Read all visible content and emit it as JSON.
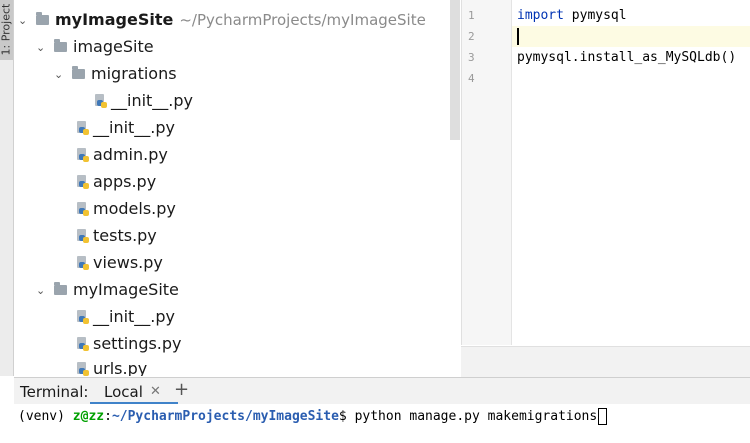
{
  "sidebar": {
    "project_tab_label": "1: Project"
  },
  "tree": {
    "root": {
      "name": "myImageSite",
      "path": "~/PycharmProjects/myImageSite"
    },
    "items": [
      {
        "label": "imageSite",
        "kind": "folder",
        "expanded": true
      },
      {
        "label": "migrations",
        "kind": "folder",
        "expanded": true
      },
      {
        "label": "__init__.py",
        "kind": "py"
      },
      {
        "label": "__init__.py",
        "kind": "py"
      },
      {
        "label": "admin.py",
        "kind": "py"
      },
      {
        "label": "apps.py",
        "kind": "py"
      },
      {
        "label": "models.py",
        "kind": "py"
      },
      {
        "label": "tests.py",
        "kind": "py"
      },
      {
        "label": "views.py",
        "kind": "py"
      },
      {
        "label": "myImageSite",
        "kind": "folder",
        "expanded": true
      },
      {
        "label": "__init__.py",
        "kind": "py"
      },
      {
        "label": "settings.py",
        "kind": "py"
      },
      {
        "label": "urls.py",
        "kind": "py"
      }
    ]
  },
  "editor": {
    "line_numbers": [
      "1",
      "2",
      "3",
      "4"
    ],
    "lines": {
      "l1_keyword": "import",
      "l1_rest": " pymysql",
      "l3": "pymysql.install_as_MySQLdb()"
    }
  },
  "terminal": {
    "label": "Terminal:",
    "tab_label": "Local",
    "prompt_env": "(venv) ",
    "prompt_user": "z@zz",
    "prompt_sep": ":",
    "prompt_path": "~/PycharmProjects/myImageSite",
    "prompt_symbol": "$ ",
    "command": "python manage.py makemigrations"
  },
  "colors": {
    "keyword": "#0033b3",
    "prompt_user": "#00a000",
    "prompt_path": "#2a5db0",
    "active_tab_underline": "#4083c9"
  }
}
